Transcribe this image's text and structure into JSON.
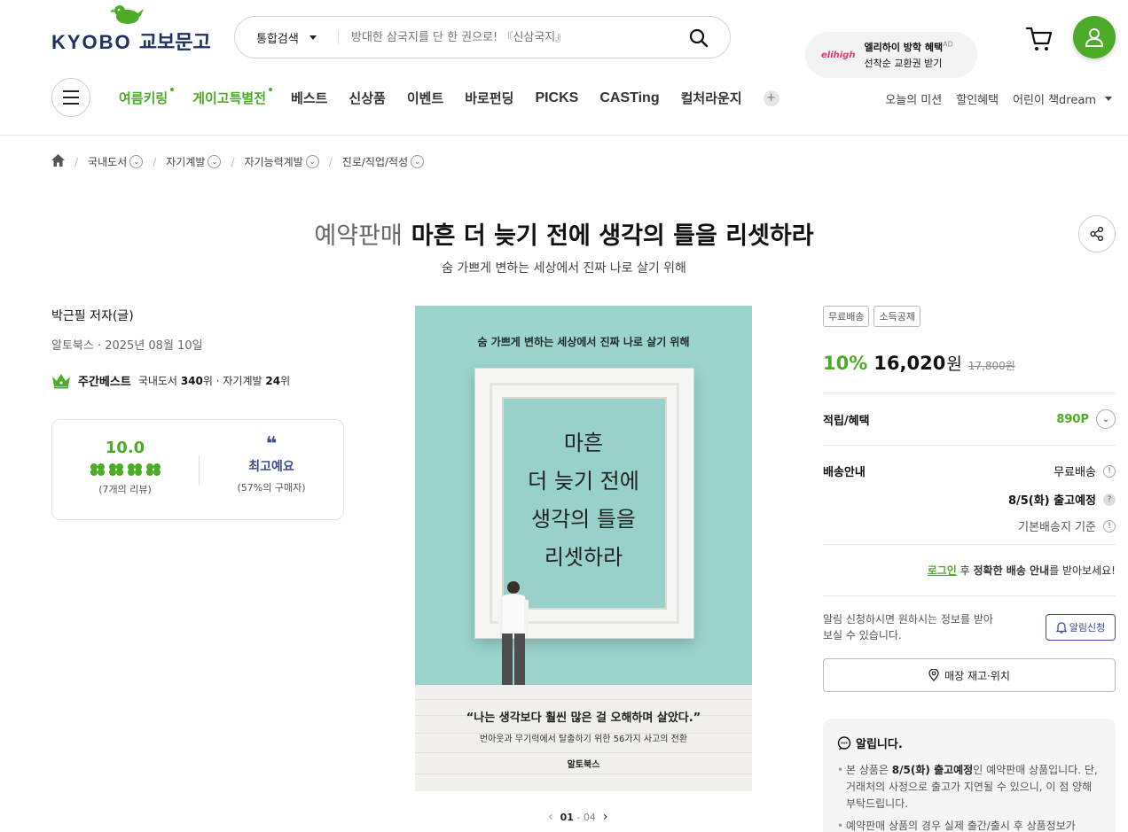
{
  "header": {
    "logo_en": "KYOBO",
    "logo_kr": "교보문고",
    "search_scope": "통합검색",
    "search_placeholder": "방대한 삼국지를 단 한 권으로! 『신삼국지』",
    "promo_brand": "elihigh",
    "promo_line1": "엘리하이 방학 혜택",
    "promo_ad": "AD",
    "promo_line2": "선착순 교환권 받기"
  },
  "nav": {
    "items": [
      "여름키링",
      "게이고특별전",
      "베스트",
      "신상품",
      "이벤트",
      "바로펀딩",
      "PICKS",
      "CASTing",
      "컬처라운지"
    ],
    "more": "+",
    "util": [
      "오늘의 미션",
      "할인혜택",
      "어린이 책dream"
    ]
  },
  "breadcrumb": [
    "국내도서",
    "자기계발",
    "자기능력계발",
    "진로/직업/적성"
  ],
  "product": {
    "badge": "예약판매",
    "title": "마흔 더 늦기 전에 생각의 틀을 리셋하라",
    "subtitle": "숨 가쁘게 변하는 세상에서 진짜 나로 살기 위해",
    "author": "박근필 저자(글)",
    "publisher_date": "알토북스 · 2025년 08월 10일",
    "best_label": "주간베스트",
    "best_rank_pre1": "국내도서",
    "best_rank1": "340",
    "best_rank_mid": "위 · 자기계발",
    "best_rank2": "24",
    "best_rank_suf": "위",
    "review_score": "10.0",
    "review_count_num": "7",
    "review_count_suf": "개의 리뷰)",
    "review_keyword": "최고예요",
    "review_keyword_pct": "57%",
    "review_keyword_suf": "의 구매자)"
  },
  "cover": {
    "top_line": "숨 가쁘게 변하는 세상에서 진짜 나로 살기 위해",
    "title_lines": [
      "마흔",
      "더 늦기 전에",
      "생각의 틀을",
      "리셋하라"
    ],
    "quote": "“나는 생각보다 훨씬 많은 걸 오해하며 살았다.”",
    "quote_sub": "번아웃과 무기력에서 탈출하기 위한 56가지 사고의 전환",
    "publisher": "알토북스",
    "pager_current": "01",
    "pager_sep": " - ",
    "pager_total": "04"
  },
  "purchase": {
    "tags": [
      "무료배송",
      "소득공제"
    ],
    "discount": "10%",
    "price": "16,020",
    "won": "원",
    "original_price": "17,800원",
    "points_label": "적립/혜택",
    "points_value": "890P",
    "delivery_label": "배송안내",
    "delivery_free": "무료배송",
    "delivery_date": "8/5(화) 출고예정",
    "delivery_basis": "기본배송지 기준",
    "login_link": "로그인",
    "login_mid": " 후 ",
    "login_bold": "정확한 배송 안내",
    "login_suf": "를 받아보세요!",
    "notify_text": "알림 신청하시면 원하시는 정보를 받아 보실 수 있습니다.",
    "notify_button": "알림신청",
    "store_button": "매장 재고·위치"
  },
  "notice": {
    "heading": "알립니다.",
    "item1_pre": "본 상품은 ",
    "item1_bold": "8/5(화) 출고예정",
    "item1_suf": "인 예약판매 상품입니다. 단, 거래처의 사정으로 출고가 지연될 수 있으니, 이 점 양해 부탁드립니다.",
    "item2": "예약판매 상품의 경우 실제 출간/출시 후 상품정보가"
  },
  "colors": {
    "brand_green": "#4dac27",
    "brand_navy": "#1b3264",
    "accent_indigo": "#3d4b8f",
    "cover_mint": "#9bd4cd"
  }
}
